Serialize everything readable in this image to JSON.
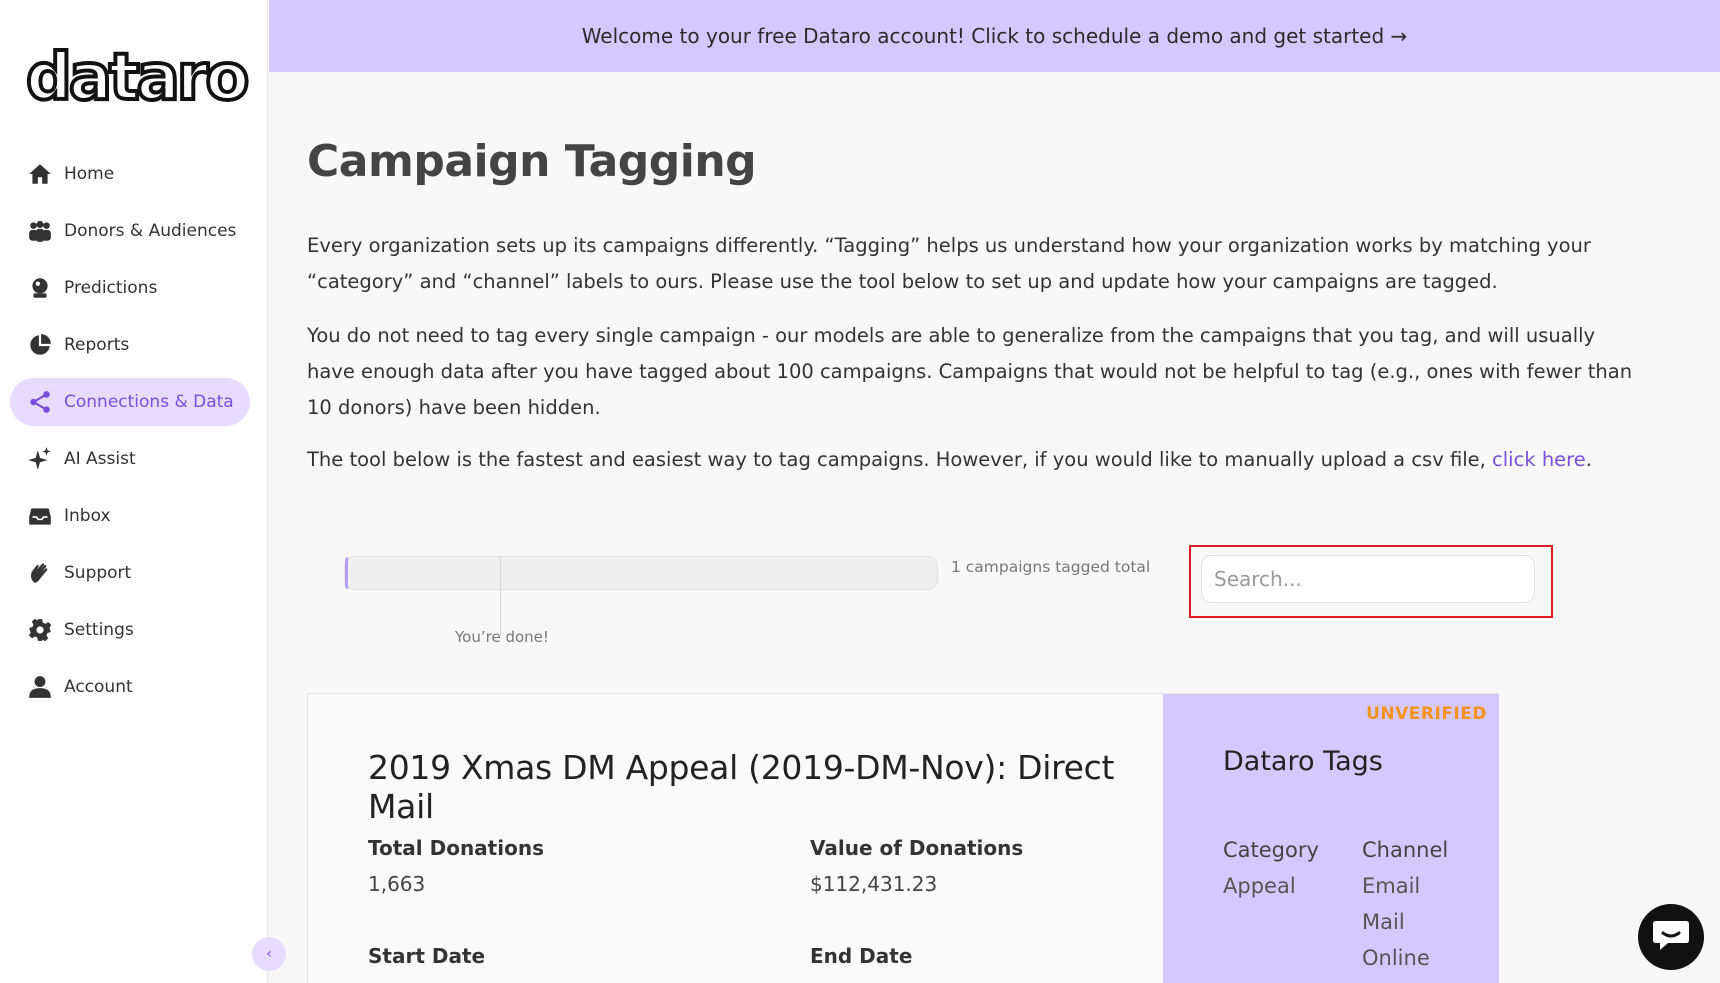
{
  "banner": {
    "text": "Welcome to your free Dataro account! Click to schedule a demo and get started →"
  },
  "sidebar": {
    "logo": "dataro",
    "items": [
      {
        "label": "Home",
        "icon": "home-icon"
      },
      {
        "label": "Donors & Audiences",
        "icon": "people-icon"
      },
      {
        "label": "Predictions",
        "icon": "crystal-ball-icon"
      },
      {
        "label": "Reports",
        "icon": "pie-chart-icon"
      },
      {
        "label": "Connections & Data",
        "icon": "share-icon",
        "active": true
      },
      {
        "label": "AI Assist",
        "icon": "sparkles-icon"
      },
      {
        "label": "Inbox",
        "icon": "inbox-icon"
      },
      {
        "label": "Support",
        "icon": "hand-wave-icon"
      },
      {
        "label": "Settings",
        "icon": "gear-icon"
      },
      {
        "label": "Account",
        "icon": "user-icon"
      }
    ],
    "collapse_label": "‹"
  },
  "main": {
    "title": "Campaign Tagging",
    "para1": "Every organization sets up its campaigns differently. “Tagging” helps us understand how your organization works by matching your “category” and “channel” labels to ours. Please use the tool below to set up and update how your campaigns are tagged.",
    "para2": "You do not need to tag every single campaign - our models are able to generalize from the campaigns that you tag, and will usually have enough data after you have tagged about 100 campaigns. Campaigns that would not be helpful to tag (e.g., ones with fewer than 10 donors) have been hidden.",
    "para3_prefix": "The tool below is the fastest and easiest way to tag campaigns. However, if you would like to manually upload a csv file, ",
    "para3_link": "click here",
    "para3_suffix": "."
  },
  "progress": {
    "tagged_count_text": "1 campaigns tagged total",
    "marker_label": "You’re done!",
    "fill_fraction": 0.005
  },
  "search": {
    "placeholder": "Search..."
  },
  "campaign": {
    "title": "2019 Xmas DM Appeal (2019-DM-Nov): Direct Mail",
    "total_donations_label": "Total Donations",
    "total_donations_value": "1,663",
    "value_donations_label": "Value of Donations",
    "value_donations_value": "$112,431.23",
    "start_date_label": "Start Date",
    "end_date_label": "End Date",
    "status": "UNVERIFIED",
    "tags_title": "Dataro Tags",
    "category_label": "Category",
    "category_values": [
      "Appeal"
    ],
    "channel_label": "Channel",
    "channel_values": [
      "Email",
      "Mail",
      "Online"
    ]
  },
  "colors": {
    "accent": "#7a4fe0",
    "banner_bg": "#d4c8ff",
    "status": "#f5921e",
    "highlight": "#e01b24"
  }
}
